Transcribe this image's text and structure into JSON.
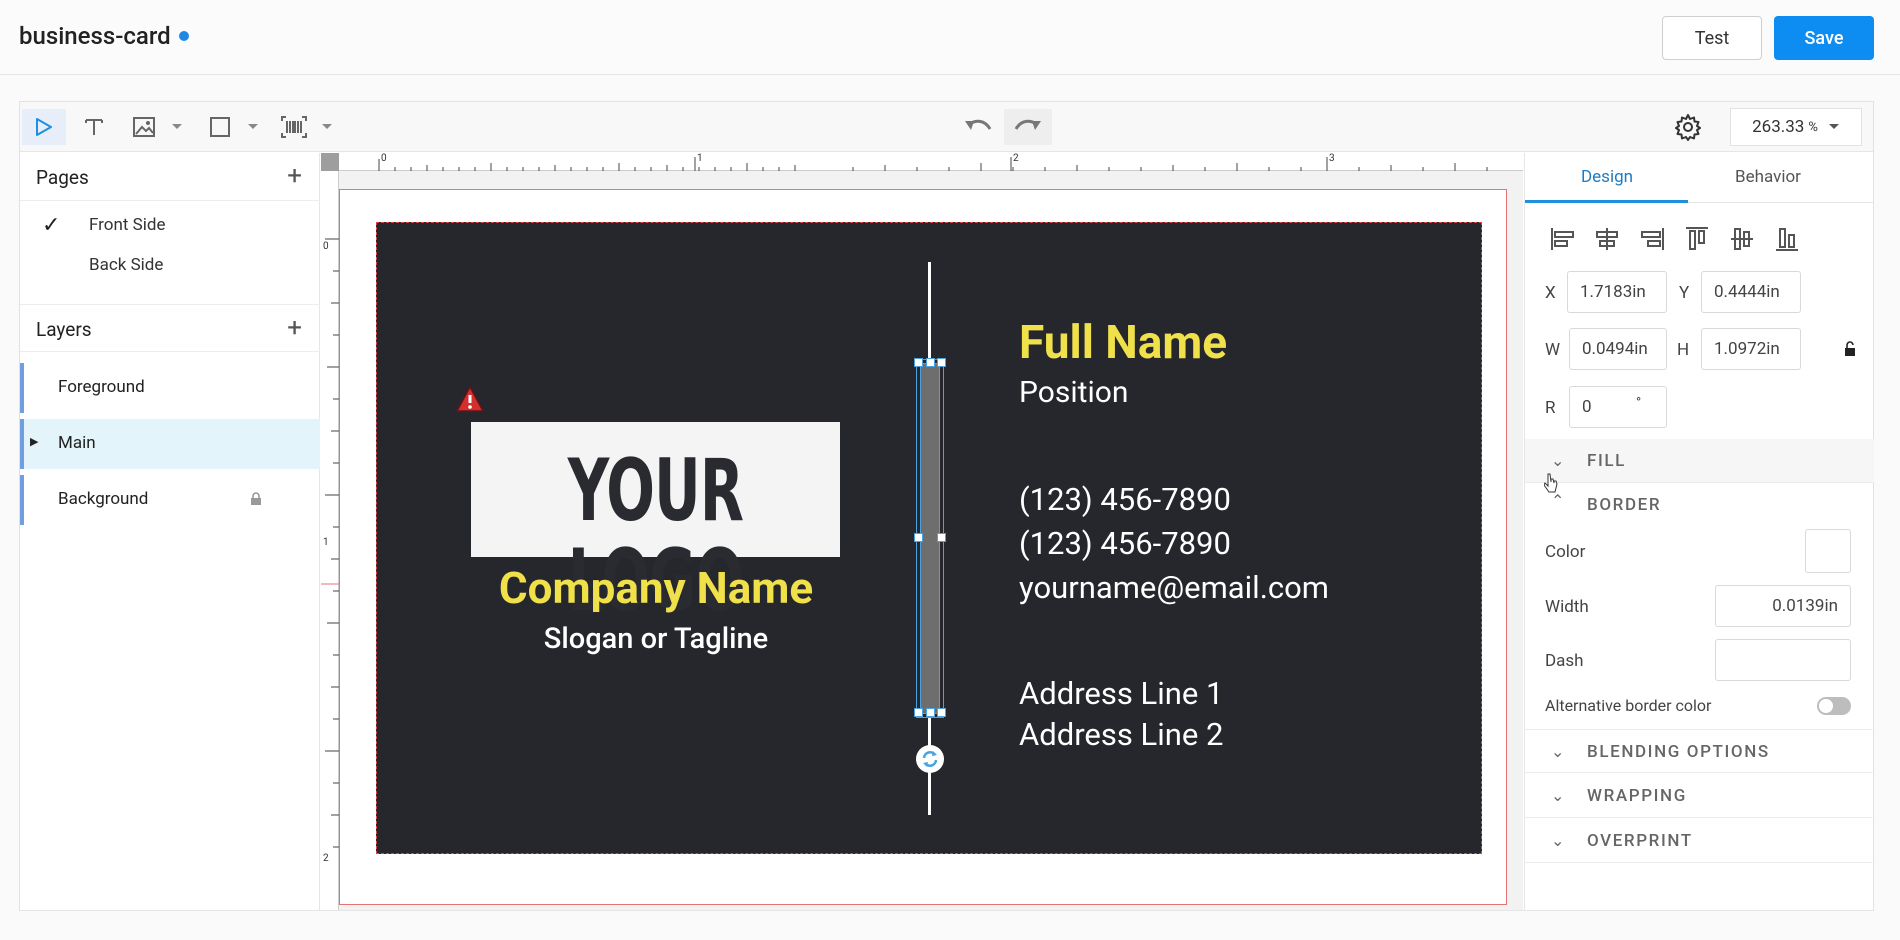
{
  "header": {
    "title": "business-card",
    "test_label": "Test",
    "save_label": "Save"
  },
  "toolbar": {
    "zoom_value": "263.33",
    "zoom_unit": "%"
  },
  "pages": {
    "title": "Pages",
    "items": [
      {
        "label": "Front Side",
        "checked": true
      },
      {
        "label": "Back Side",
        "checked": false
      }
    ]
  },
  "layers": {
    "title": "Layers",
    "items": [
      {
        "label": "Foreground"
      },
      {
        "label": "Main"
      },
      {
        "label": "Background"
      }
    ]
  },
  "rulers": {
    "top": [
      "0",
      "1",
      "2",
      "3"
    ],
    "left": [
      "0",
      "1",
      "2"
    ]
  },
  "card": {
    "logo_text": "YOUR LOGO",
    "company_name": "Company Name",
    "slogan": "Slogan or Tagline",
    "full_name": "Full Name",
    "position": "Position",
    "phone1": "(123) 456-7890",
    "phone2": "(123) 456-7890",
    "email": "yourname@email.com",
    "address1": "Address Line 1",
    "address2": "Address Line 2",
    "colors": {
      "background": "#26272d",
      "accent": "#f0e14a",
      "text": "#ffffff"
    }
  },
  "design_panel": {
    "tab_design": "Design",
    "tab_behavior": "Behavior",
    "x_label": "X",
    "x_value": "1.7183",
    "y_label": "Y",
    "y_value": "0.4444",
    "w_label": "W",
    "w_value": "0.0494",
    "h_label": "H",
    "h_value": "1.0972",
    "r_label": "R",
    "r_value": "0",
    "unit": "in",
    "deg": "°",
    "fill_label": "FILL",
    "border_label": "BORDER",
    "color_label": "Color",
    "width_label": "Width",
    "width_value": "0.0139",
    "dash_label": "Dash",
    "alt_border_label": "Alternative border color",
    "blending_label": "BLENDING OPTIONS",
    "wrapping_label": "WRAPPING",
    "overprint_label": "OVERPRINT"
  }
}
